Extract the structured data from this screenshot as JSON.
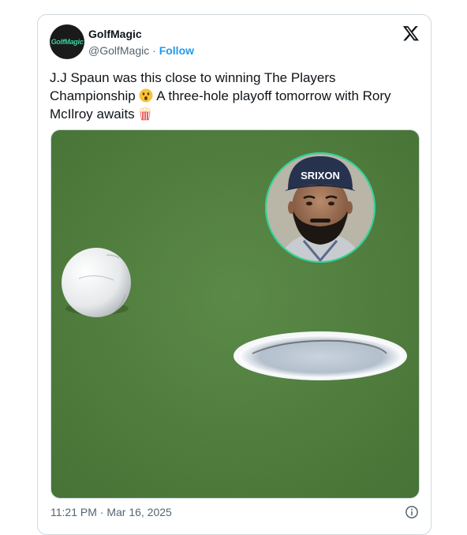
{
  "post": {
    "author_name": "GolfMagic",
    "avatar_text": "GolfMagic",
    "handle": "@GolfMagic",
    "separator": "·",
    "follow_label": "Follow",
    "text_part1": "J.J Spaun was this close to winning The Players Championship",
    "text_part2": "A three-hole playoff tomorrow with Rory McIlroy awaits",
    "timestamp": "11:21 PM · Mar 16, 2025",
    "cap_logo": "SRIXON"
  },
  "icons": {
    "platform": "x-logo-icon",
    "emoji1": "astonished-face-icon",
    "emoji2": "popcorn-icon",
    "info": "info-icon"
  },
  "colors": {
    "follow": "#1d9bf0",
    "secondary_text": "#536471",
    "border": "#cfd9de",
    "green_turf": "#4f7a3a",
    "avatar_ring": "#34d399"
  }
}
